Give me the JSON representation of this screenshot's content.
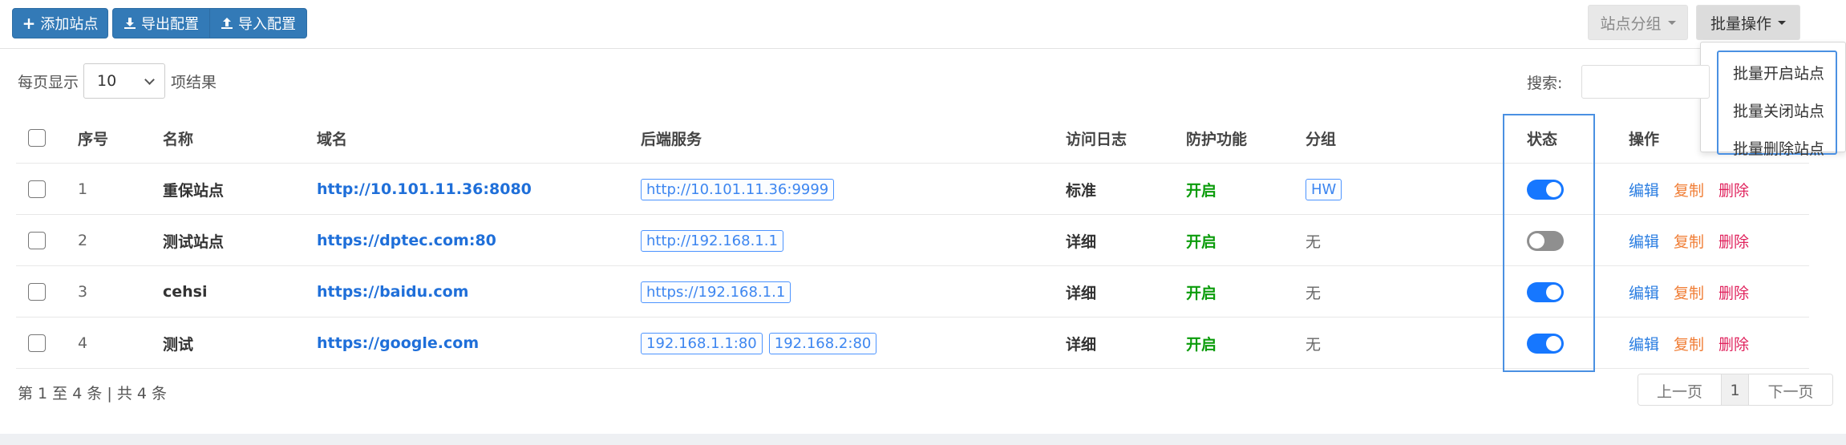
{
  "toolbar": {
    "add_label": "添加站点",
    "export_label": "导出配置",
    "import_label": "导入配置",
    "group_label": "站点分组",
    "batch_label": "批量操作"
  },
  "batch_menu": [
    "批量开启站点",
    "批量关闭站点",
    "批量删除站点"
  ],
  "length": {
    "prefix": "每页显示",
    "value": "10",
    "suffix": "项结果"
  },
  "search": {
    "label": "搜索:",
    "value": ""
  },
  "columns": [
    "序号",
    "名称",
    "域名",
    "后端服务",
    "访问日志",
    "防护功能",
    "分组",
    "状态",
    "操作"
  ],
  "rows": [
    {
      "no": "1",
      "name": "重保站点",
      "domain": "http://10.101.11.36:8080",
      "backends": [
        "http://10.101.11.36:9999"
      ],
      "log": "标准",
      "protect": "开启",
      "group": "HW",
      "group_tag": true,
      "enabled": true
    },
    {
      "no": "2",
      "name": "测试站点",
      "domain": "https://dptec.com:80",
      "backends": [
        "http://192.168.1.1"
      ],
      "log": "详细",
      "protect": "开启",
      "group": "无",
      "group_tag": false,
      "enabled": false
    },
    {
      "no": "3",
      "name": "cehsi",
      "domain": "https://baidu.com",
      "backends": [
        "https://192.168.1.1"
      ],
      "log": "详细",
      "protect": "开启",
      "group": "无",
      "group_tag": false,
      "enabled": true
    },
    {
      "no": "4",
      "name": "测试",
      "domain": "https://google.com",
      "backends": [
        "192.168.1.1:80",
        "192.168.2:80"
      ],
      "log": "详细",
      "protect": "开启",
      "group": "无",
      "group_tag": false,
      "enabled": true
    }
  ],
  "actions": {
    "edit": "编辑",
    "copy": "复制",
    "delete": "删除"
  },
  "info": "第 1 至 4 条 | 共 4 条",
  "pagination": {
    "prev": "上一页",
    "current": "1",
    "next": "下一页"
  },
  "colors": {
    "primary": "#337ab7",
    "toggle_on": "#1677ff",
    "toggle_off": "#8f8f8f",
    "link": "#1f6fd9",
    "enabled_text": "#0b9c0b",
    "copy": "#f07e36",
    "delete": "#e0245e"
  }
}
